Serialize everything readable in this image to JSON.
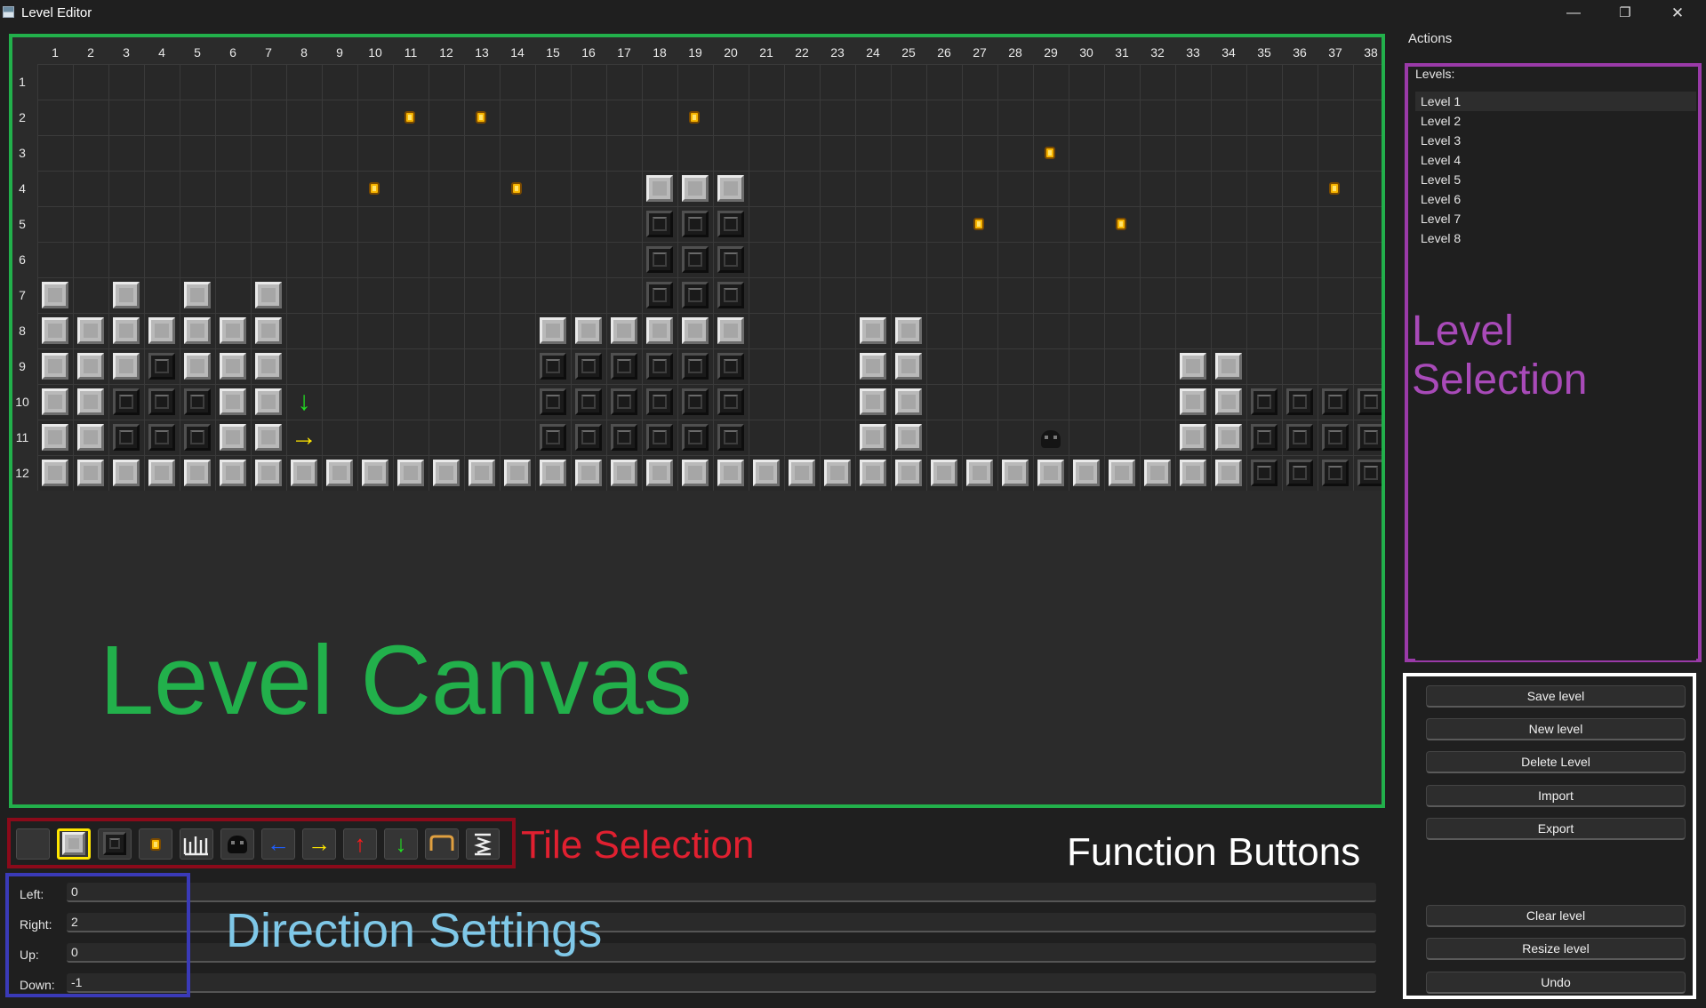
{
  "window": {
    "title": "Level Editor",
    "minimize": "—",
    "restore": "❐",
    "close": "✕"
  },
  "canvas": {
    "columns": [
      "1",
      "2",
      "3",
      "4",
      "5",
      "6",
      "7",
      "8",
      "9",
      "10",
      "11",
      "12",
      "13",
      "14",
      "15",
      "16",
      "17",
      "18",
      "19",
      "20",
      "21",
      "22",
      "23",
      "24",
      "25",
      "26",
      "27",
      "28",
      "29",
      "30",
      "31",
      "32",
      "33",
      "34",
      "35",
      "36",
      "37",
      "38"
    ],
    "rows": [
      "1",
      "2",
      "3",
      "4",
      "5",
      "6",
      "7",
      "8",
      "9",
      "10",
      "11",
      "12"
    ],
    "tiles": [
      {
        "r": 2,
        "c": 11,
        "t": "coin"
      },
      {
        "r": 2,
        "c": 13,
        "t": "coin"
      },
      {
        "r": 2,
        "c": 19,
        "t": "coin"
      },
      {
        "r": 3,
        "c": 29,
        "t": "coin"
      },
      {
        "r": 4,
        "c": 10,
        "t": "coin"
      },
      {
        "r": 4,
        "c": 14,
        "t": "coin"
      },
      {
        "r": 4,
        "c": 18,
        "t": "block"
      },
      {
        "r": 4,
        "c": 19,
        "t": "block"
      },
      {
        "r": 4,
        "c": 20,
        "t": "block"
      },
      {
        "r": 4,
        "c": 37,
        "t": "coin"
      },
      {
        "r": 5,
        "c": 18,
        "t": "dark"
      },
      {
        "r": 5,
        "c": 19,
        "t": "dark"
      },
      {
        "r": 5,
        "c": 20,
        "t": "dark"
      },
      {
        "r": 5,
        "c": 27,
        "t": "coin"
      },
      {
        "r": 5,
        "c": 31,
        "t": "coin"
      },
      {
        "r": 6,
        "c": 18,
        "t": "dark"
      },
      {
        "r": 6,
        "c": 19,
        "t": "dark"
      },
      {
        "r": 6,
        "c": 20,
        "t": "dark"
      },
      {
        "r": 7,
        "c": 1,
        "t": "block"
      },
      {
        "r": 7,
        "c": 3,
        "t": "block"
      },
      {
        "r": 7,
        "c": 5,
        "t": "block"
      },
      {
        "r": 7,
        "c": 7,
        "t": "block"
      },
      {
        "r": 7,
        "c": 18,
        "t": "dark"
      },
      {
        "r": 7,
        "c": 19,
        "t": "dark"
      },
      {
        "r": 7,
        "c": 20,
        "t": "dark"
      },
      {
        "r": 8,
        "c": 1,
        "t": "block"
      },
      {
        "r": 8,
        "c": 2,
        "t": "block"
      },
      {
        "r": 8,
        "c": 3,
        "t": "block"
      },
      {
        "r": 8,
        "c": 4,
        "t": "block"
      },
      {
        "r": 8,
        "c": 5,
        "t": "block"
      },
      {
        "r": 8,
        "c": 6,
        "t": "block"
      },
      {
        "r": 8,
        "c": 7,
        "t": "block"
      },
      {
        "r": 8,
        "c": 15,
        "t": "block"
      },
      {
        "r": 8,
        "c": 16,
        "t": "block"
      },
      {
        "r": 8,
        "c": 17,
        "t": "block"
      },
      {
        "r": 8,
        "c": 18,
        "t": "block"
      },
      {
        "r": 8,
        "c": 19,
        "t": "block"
      },
      {
        "r": 8,
        "c": 20,
        "t": "block"
      },
      {
        "r": 8,
        "c": 24,
        "t": "block"
      },
      {
        "r": 8,
        "c": 25,
        "t": "block"
      },
      {
        "r": 9,
        "c": 1,
        "t": "block"
      },
      {
        "r": 9,
        "c": 2,
        "t": "block"
      },
      {
        "r": 9,
        "c": 3,
        "t": "block"
      },
      {
        "r": 9,
        "c": 4,
        "t": "dark"
      },
      {
        "r": 9,
        "c": 5,
        "t": "block"
      },
      {
        "r": 9,
        "c": 6,
        "t": "block"
      },
      {
        "r": 9,
        "c": 7,
        "t": "block"
      },
      {
        "r": 9,
        "c": 15,
        "t": "dark"
      },
      {
        "r": 9,
        "c": 16,
        "t": "dark"
      },
      {
        "r": 9,
        "c": 17,
        "t": "dark"
      },
      {
        "r": 9,
        "c": 18,
        "t": "dark"
      },
      {
        "r": 9,
        "c": 19,
        "t": "dark"
      },
      {
        "r": 9,
        "c": 20,
        "t": "dark"
      },
      {
        "r": 9,
        "c": 24,
        "t": "block"
      },
      {
        "r": 9,
        "c": 25,
        "t": "block"
      },
      {
        "r": 9,
        "c": 33,
        "t": "block"
      },
      {
        "r": 9,
        "c": 34,
        "t": "block"
      },
      {
        "r": 10,
        "c": 1,
        "t": "block"
      },
      {
        "r": 10,
        "c": 2,
        "t": "block"
      },
      {
        "r": 10,
        "c": 3,
        "t": "dark"
      },
      {
        "r": 10,
        "c": 4,
        "t": "dark"
      },
      {
        "r": 10,
        "c": 5,
        "t": "dark"
      },
      {
        "r": 10,
        "c": 6,
        "t": "block"
      },
      {
        "r": 10,
        "c": 7,
        "t": "block"
      },
      {
        "r": 10,
        "c": 8,
        "t": "arrow-down"
      },
      {
        "r": 10,
        "c": 15,
        "t": "dark"
      },
      {
        "r": 10,
        "c": 16,
        "t": "dark"
      },
      {
        "r": 10,
        "c": 17,
        "t": "dark"
      },
      {
        "r": 10,
        "c": 18,
        "t": "dark"
      },
      {
        "r": 10,
        "c": 19,
        "t": "dark"
      },
      {
        "r": 10,
        "c": 20,
        "t": "dark"
      },
      {
        "r": 10,
        "c": 24,
        "t": "block"
      },
      {
        "r": 10,
        "c": 25,
        "t": "block"
      },
      {
        "r": 10,
        "c": 33,
        "t": "block"
      },
      {
        "r": 10,
        "c": 34,
        "t": "block"
      },
      {
        "r": 10,
        "c": 35,
        "t": "dark"
      },
      {
        "r": 10,
        "c": 36,
        "t": "dark"
      },
      {
        "r": 10,
        "c": 37,
        "t": "dark"
      },
      {
        "r": 10,
        "c": 38,
        "t": "dark"
      },
      {
        "r": 11,
        "c": 1,
        "t": "block"
      },
      {
        "r": 11,
        "c": 2,
        "t": "block"
      },
      {
        "r": 11,
        "c": 3,
        "t": "dark"
      },
      {
        "r": 11,
        "c": 4,
        "t": "dark"
      },
      {
        "r": 11,
        "c": 5,
        "t": "dark"
      },
      {
        "r": 11,
        "c": 6,
        "t": "block"
      },
      {
        "r": 11,
        "c": 7,
        "t": "block"
      },
      {
        "r": 11,
        "c": 8,
        "t": "arrow-right"
      },
      {
        "r": 11,
        "c": 15,
        "t": "dark"
      },
      {
        "r": 11,
        "c": 16,
        "t": "dark"
      },
      {
        "r": 11,
        "c": 17,
        "t": "dark"
      },
      {
        "r": 11,
        "c": 18,
        "t": "dark"
      },
      {
        "r": 11,
        "c": 19,
        "t": "dark"
      },
      {
        "r": 11,
        "c": 20,
        "t": "dark"
      },
      {
        "r": 11,
        "c": 24,
        "t": "block"
      },
      {
        "r": 11,
        "c": 25,
        "t": "block"
      },
      {
        "r": 11,
        "c": 29,
        "t": "enemy"
      },
      {
        "r": 11,
        "c": 33,
        "t": "block"
      },
      {
        "r": 11,
        "c": 34,
        "t": "block"
      },
      {
        "r": 11,
        "c": 35,
        "t": "dark"
      },
      {
        "r": 11,
        "c": 36,
        "t": "dark"
      },
      {
        "r": 11,
        "c": 37,
        "t": "dark"
      },
      {
        "r": 11,
        "c": 38,
        "t": "dark"
      },
      {
        "r": 12,
        "c": 1,
        "t": "block"
      },
      {
        "r": 12,
        "c": 2,
        "t": "block"
      },
      {
        "r": 12,
        "c": 3,
        "t": "block"
      },
      {
        "r": 12,
        "c": 4,
        "t": "block"
      },
      {
        "r": 12,
        "c": 5,
        "t": "block"
      },
      {
        "r": 12,
        "c": 6,
        "t": "block"
      },
      {
        "r": 12,
        "c": 7,
        "t": "block"
      },
      {
        "r": 12,
        "c": 8,
        "t": "block"
      },
      {
        "r": 12,
        "c": 9,
        "t": "block"
      },
      {
        "r": 12,
        "c": 10,
        "t": "block"
      },
      {
        "r": 12,
        "c": 11,
        "t": "block"
      },
      {
        "r": 12,
        "c": 12,
        "t": "block"
      },
      {
        "r": 12,
        "c": 13,
        "t": "block"
      },
      {
        "r": 12,
        "c": 14,
        "t": "block"
      },
      {
        "r": 12,
        "c": 15,
        "t": "block"
      },
      {
        "r": 12,
        "c": 16,
        "t": "block"
      },
      {
        "r": 12,
        "c": 17,
        "t": "block"
      },
      {
        "r": 12,
        "c": 18,
        "t": "block"
      },
      {
        "r": 12,
        "c": 19,
        "t": "block"
      },
      {
        "r": 12,
        "c": 20,
        "t": "block"
      },
      {
        "r": 12,
        "c": 21,
        "t": "block"
      },
      {
        "r": 12,
        "c": 22,
        "t": "block"
      },
      {
        "r": 12,
        "c": 23,
        "t": "block"
      },
      {
        "r": 12,
        "c": 24,
        "t": "block"
      },
      {
        "r": 12,
        "c": 25,
        "t": "block"
      },
      {
        "r": 12,
        "c": 26,
        "t": "block"
      },
      {
        "r": 12,
        "c": 27,
        "t": "block"
      },
      {
        "r": 12,
        "c": 28,
        "t": "block"
      },
      {
        "r": 12,
        "c": 29,
        "t": "block"
      },
      {
        "r": 12,
        "c": 30,
        "t": "block"
      },
      {
        "r": 12,
        "c": 31,
        "t": "block"
      },
      {
        "r": 12,
        "c": 32,
        "t": "block"
      },
      {
        "r": 12,
        "c": 33,
        "t": "block"
      },
      {
        "r": 12,
        "c": 34,
        "t": "block"
      },
      {
        "r": 12,
        "c": 35,
        "t": "dark"
      },
      {
        "r": 12,
        "c": 36,
        "t": "dark"
      },
      {
        "r": 12,
        "c": 37,
        "t": "dark"
      },
      {
        "r": 12,
        "c": 38,
        "t": "dark"
      }
    ]
  },
  "annotations": {
    "canvas": "Level Canvas",
    "tiles": "Tile Selection",
    "direction": "Direction Settings",
    "functions": "Function Buttons",
    "levels": "Level Selection"
  },
  "palette": [
    {
      "name": "empty",
      "glyph": "",
      "color": "#ffffff"
    },
    {
      "name": "block",
      "glyph": "",
      "color": "#ffffff",
      "selected": true
    },
    {
      "name": "dark-block",
      "glyph": "",
      "color": "#ffffff"
    },
    {
      "name": "coin",
      "glyph": "",
      "color": "#f6b400"
    },
    {
      "name": "spikes",
      "glyph": "",
      "color": "#ffffff"
    },
    {
      "name": "enemy",
      "glyph": "",
      "color": "#ffffff"
    },
    {
      "name": "arrow-left",
      "glyph": "←",
      "color": "#1f5fff"
    },
    {
      "name": "arrow-right",
      "glyph": "→",
      "color": "#ffe600"
    },
    {
      "name": "arrow-up",
      "glyph": "↑",
      "color": "#ff1a1a"
    },
    {
      "name": "arrow-down",
      "glyph": "↓",
      "color": "#22dd22"
    },
    {
      "name": "bounce",
      "glyph": "",
      "color": "#e0a040"
    },
    {
      "name": "spring",
      "glyph": "",
      "color": "#ffffff"
    }
  ],
  "direction": {
    "left_label": "Left:",
    "left_value": "0",
    "right_label": "Right:",
    "right_value": "2",
    "up_label": "Up:",
    "up_value": "0",
    "down_label": "Down:",
    "down_value": "-1"
  },
  "actions": {
    "title": "Actions",
    "levels_label": "Levels:",
    "levels": [
      "Level 1",
      "Level 2",
      "Level 3",
      "Level 4",
      "Level 5",
      "Level 6",
      "Level 7",
      "Level 8"
    ],
    "selected_level": "Level 1",
    "buttons": {
      "save": "Save level",
      "new": "New level",
      "delete": "Delete Level",
      "import": "Import",
      "export": "Export",
      "clear": "Clear level",
      "resize": "Resize level",
      "undo": "Undo"
    }
  },
  "colors": {
    "canvas_border": "#22b04b",
    "tiles_border": "#8b0a1a",
    "direction_border": "#3a3ab8",
    "levels_border": "#9a3aa8",
    "functions_border": "#ffffff",
    "canvas_label": "#22b04b",
    "tiles_label": "#e02030",
    "direction_label": "#7fc8e8",
    "levels_label": "#a84ab8"
  }
}
